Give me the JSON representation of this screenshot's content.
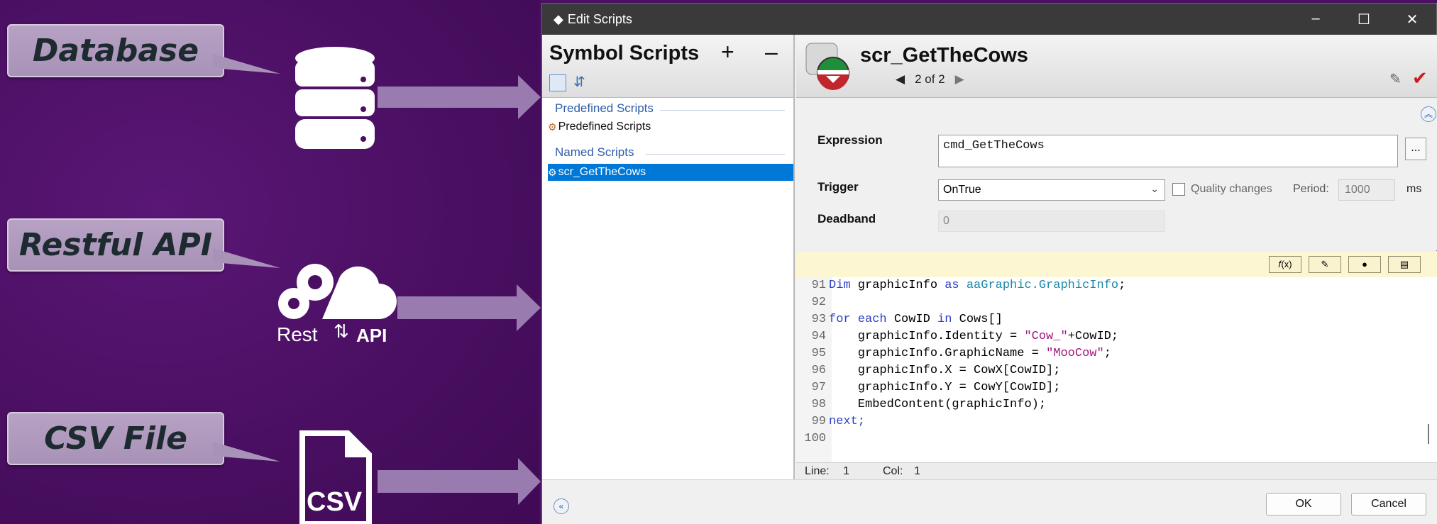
{
  "callouts": {
    "database": "Database",
    "restful": "Restful API",
    "csv": "CSV File"
  },
  "icons": {
    "api_rest": "Rest",
    "api_api": "API",
    "csv_text": "CSV"
  },
  "window": {
    "title": "Edit Scripts",
    "controls": {
      "minimize": "–",
      "maximize": "☐",
      "close": "✕"
    }
  },
  "left_pane": {
    "title": "Symbol Scripts",
    "add": "+",
    "remove": "–",
    "groups": [
      {
        "label": "Predefined Scripts",
        "items": [
          "Predefined Scripts"
        ]
      },
      {
        "label": "Named Scripts",
        "items": [
          "scr_GetTheCows"
        ]
      }
    ]
  },
  "script": {
    "name": "scr_GetTheCows",
    "nav_prev": "◀",
    "nav_pos": "2 of 2",
    "nav_next": "▶"
  },
  "form": {
    "expression_label": "Expression",
    "expression_value": "cmd_GetTheCows",
    "browse": "...",
    "trigger_label": "Trigger",
    "trigger_value": "OnTrue",
    "quality_label": "Quality changes",
    "period_label": "Period:",
    "period_value": "1000",
    "period_unit": "ms",
    "deadband_label": "Deadband",
    "deadband_value": "0"
  },
  "code_lines": [
    {
      "n": "91",
      "text": "Dim graphicInfo as aaGraphic.GraphicInfo;"
    },
    {
      "n": "92",
      "text": ""
    },
    {
      "n": "93",
      "text": "for each CowID in Cows[]"
    },
    {
      "n": "94",
      "text": "    graphicInfo.Identity = \"Cow_\"+CowID;"
    },
    {
      "n": "95",
      "text": "    graphicInfo.GraphicName = \"MooCow\";"
    },
    {
      "n": "96",
      "text": "    graphicInfo.X = CowX[CowID];"
    },
    {
      "n": "97",
      "text": "    graphicInfo.Y = CowY[CowID];"
    },
    {
      "n": "98",
      "text": "    EmbedContent(graphicInfo);"
    },
    {
      "n": "99",
      "text": "next;"
    },
    {
      "n": "100",
      "text": ""
    }
  ],
  "status": {
    "line_label": "Line:",
    "line_value": "1",
    "col_label": "Col:",
    "col_value": "1"
  },
  "footer": {
    "ok": "OK",
    "cancel": "Cancel"
  },
  "colors": {
    "background": "#4a0f62",
    "callout": "#b09bbd",
    "arrow": "#9a7bb0",
    "selection": "#0078d7",
    "keyword": "#2a3fc9",
    "string": "#a3157c"
  }
}
